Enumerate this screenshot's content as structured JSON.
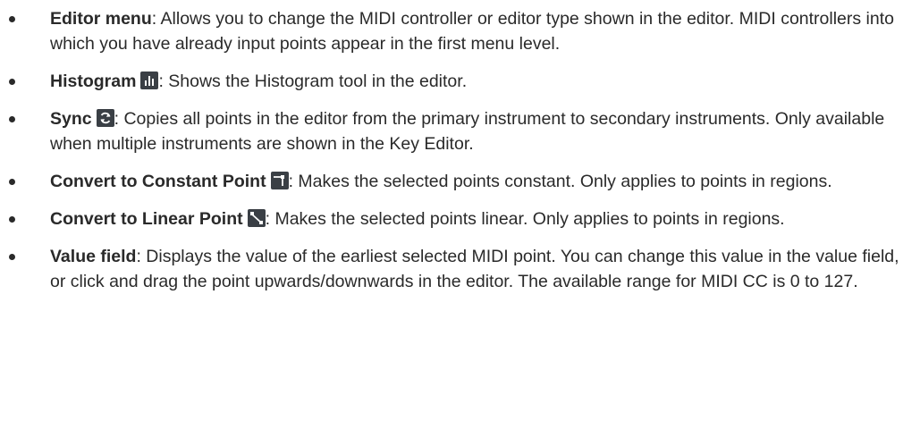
{
  "items": [
    {
      "term": "Editor menu",
      "description": ": Allows you to change the MIDI controller or editor type shown in the editor. MIDI controllers into which you have already input points appear in the first menu level."
    },
    {
      "term": "Histogram",
      "icon": "histogram-icon",
      "description": ": Shows the Histogram tool in the editor."
    },
    {
      "term": "Sync",
      "icon": "sync-icon",
      "description": ": Copies all points in the editor from the primary instrument to secondary instruments. Only available when multiple instruments are shown in the Key Editor."
    },
    {
      "term": "Convert to Constant Point",
      "icon": "constant-point-icon",
      "description": ": Makes the selected points constant. Only applies to points in regions."
    },
    {
      "term": "Convert to Linear Point",
      "icon": "linear-point-icon",
      "description": ": Makes the selected points linear. Only applies to points in regions."
    },
    {
      "term": "Value field",
      "description": ": Displays the value of the earliest selected MIDI point. You can change this value in the value field, or click and drag the point upwards/downwards in the editor. The available range for MIDI CC is 0 to 127."
    }
  ],
  "colors": {
    "text": "#2a2a2a",
    "icon_background": "#3a3f45",
    "icon_foreground": "#ffffff"
  }
}
